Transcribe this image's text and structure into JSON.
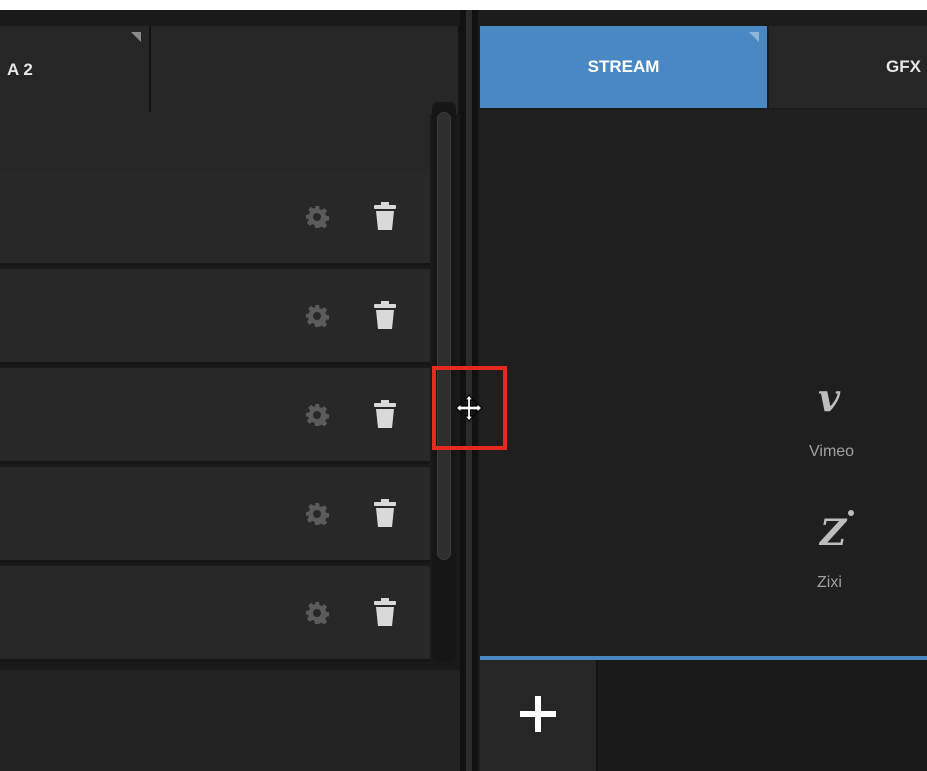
{
  "left_panel": {
    "tabs": [
      {
        "label": "A 2"
      },
      {
        "label": ""
      }
    ],
    "rows": [
      {
        "settings_icon": "gear-icon",
        "delete_icon": "trash-icon"
      },
      {
        "settings_icon": "gear-icon",
        "delete_icon": "trash-icon"
      },
      {
        "settings_icon": "gear-icon",
        "delete_icon": "trash-icon"
      },
      {
        "settings_icon": "gear-icon",
        "delete_icon": "trash-icon"
      },
      {
        "settings_icon": "gear-icon",
        "delete_icon": "trash-icon"
      }
    ]
  },
  "right_panel": {
    "tabs": [
      {
        "label": "STREAM",
        "active": true
      },
      {
        "label": "GFX",
        "active": false
      }
    ],
    "services": [
      {
        "icon": "vimeo-logo-icon",
        "label": "Vimeo"
      },
      {
        "icon": "zixi-logo-icon",
        "label": "Zixi"
      }
    ],
    "add_button_icon": "plus-icon"
  },
  "cursor": {
    "icon": "resize-move-cursor-icon"
  },
  "colors": {
    "accent": "#4a88c4",
    "highlight": "#e52b1e",
    "panel": "#282828",
    "background": "#1c1c1c"
  }
}
